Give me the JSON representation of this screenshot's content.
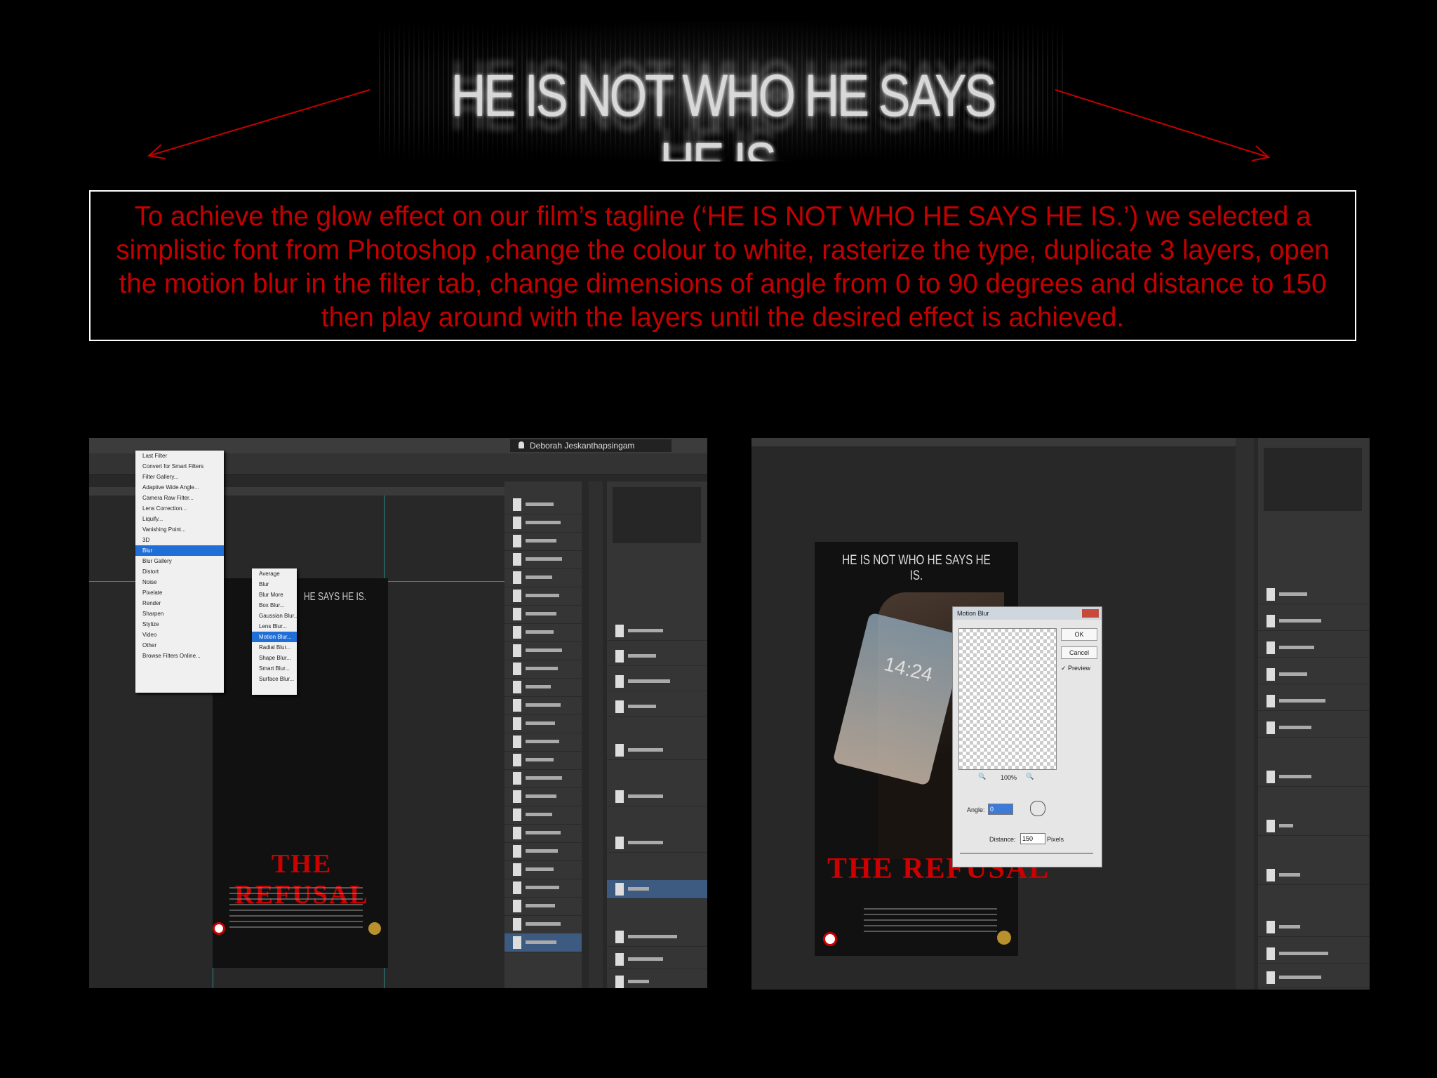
{
  "slide": {
    "tagline": "HE IS NOT WHO HE SAYS HE IS.",
    "explanation": "To achieve the glow effect on our film’s tagline (‘HE IS NOT WHO HE SAYS HE IS.’) we selected a simplistic font from Photoshop ,change the colour to white, rasterize the type, duplicate 3 layers, open the motion blur in the filter tab, change dimensions of angle from 0 to 90 degrees and distance to 150 then play around with the layers until the desired effect is achieved.",
    "accent_color": "#c40000"
  },
  "left_screenshot": {
    "user_name": "Deborah Jeskanthapsingam",
    "poster_tagline_fragment": "HE SAYS HE IS.",
    "poster_title": "THE REFUSAL",
    "filter_menu": {
      "items": [
        "Last Filter",
        "Convert for Smart Filters",
        "Filter Gallery...",
        "Adaptive Wide Angle...",
        "Camera Raw Filter...",
        "Lens Correction...",
        "Liquify...",
        "Vanishing Point...",
        "3D",
        "Blur",
        "Blur Gallery",
        "Distort",
        "Noise",
        "Pixelate",
        "Render",
        "Sharpen",
        "Stylize",
        "Video",
        "Other",
        "Browse Filters Online..."
      ],
      "selected": "Blur"
    },
    "blur_submenu": {
      "items": [
        "Average",
        "Blur",
        "Blur More",
        "Box Blur...",
        "Gaussian Blur...",
        "Lens Blur...",
        "Motion Blur...",
        "Radial Blur...",
        "Shape Blur...",
        "Smart Blur...",
        "Surface Blur..."
      ],
      "selected": "Motion Blur..."
    }
  },
  "right_screenshot": {
    "poster_tagline": "HE IS NOT WHO HE SAYS HE IS.",
    "poster_title": "THE REFUSAL",
    "phone_time": "14:24",
    "dialog": {
      "title": "Motion Blur",
      "ok_label": "OK",
      "cancel_label": "Cancel",
      "preview_label": "Preview",
      "zoom": "100%",
      "angle_label": "Angle:",
      "angle_value": "0",
      "distance_label": "Distance:",
      "distance_value": "150",
      "distance_unit": "Pixels"
    }
  }
}
